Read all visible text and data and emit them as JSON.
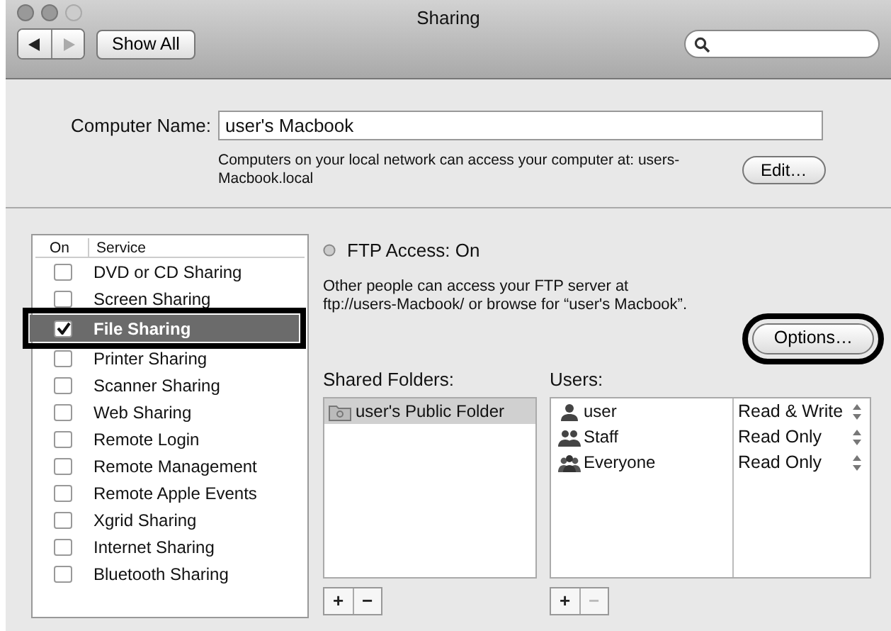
{
  "window": {
    "title": "Sharing"
  },
  "toolbar": {
    "show_all": "Show All",
    "back_disabled": false,
    "forward_disabled": true
  },
  "computer_name": {
    "label": "Computer Name:",
    "value": "user's Macbook",
    "note": "Computers on your local network can access your computer at: users-\nMacbook.local",
    "edit_button": "Edit…"
  },
  "services": {
    "columns": [
      "On",
      "Service"
    ],
    "items": [
      {
        "name": "DVD or CD Sharing",
        "checked": false,
        "selected": false
      },
      {
        "name": "Screen Sharing",
        "checked": false,
        "selected": false
      },
      {
        "name": "File Sharing",
        "checked": true,
        "selected": true
      },
      {
        "name": "Printer Sharing",
        "checked": false,
        "selected": false
      },
      {
        "name": "Scanner Sharing",
        "checked": false,
        "selected": false
      },
      {
        "name": "Web Sharing",
        "checked": false,
        "selected": false
      },
      {
        "name": "Remote Login",
        "checked": false,
        "selected": false
      },
      {
        "name": "Remote Management",
        "checked": false,
        "selected": false
      },
      {
        "name": "Remote Apple Events",
        "checked": false,
        "selected": false
      },
      {
        "name": "Xgrid Sharing",
        "checked": false,
        "selected": false
      },
      {
        "name": "Internet Sharing",
        "checked": false,
        "selected": false
      },
      {
        "name": "Bluetooth Sharing",
        "checked": false,
        "selected": false
      }
    ]
  },
  "status": {
    "text": "FTP Access: On"
  },
  "description": "Other people can access your FTP server at\nftp://users-Macbook/ or browse for “user's Macbook”.",
  "options_button": {
    "label": "Options…",
    "callout": true
  },
  "shared_folders": {
    "label": "Shared Folders:",
    "items": [
      {
        "name": "user's Public Folder",
        "selected": true
      }
    ],
    "buttons": [
      {
        "label": "+",
        "disabled": false
      },
      {
        "label": "−",
        "disabled": false
      }
    ]
  },
  "users": {
    "label": "Users:",
    "items": [
      {
        "name": "user",
        "kind": "user",
        "permission": "Read & Write"
      },
      {
        "name": "Staff",
        "kind": "group",
        "permission": "Read Only"
      },
      {
        "name": "Everyone",
        "kind": "everyone",
        "permission": "Read Only"
      }
    ],
    "buttons": [
      {
        "label": "+",
        "disabled": false
      },
      {
        "label": "−",
        "disabled": true
      }
    ]
  }
}
